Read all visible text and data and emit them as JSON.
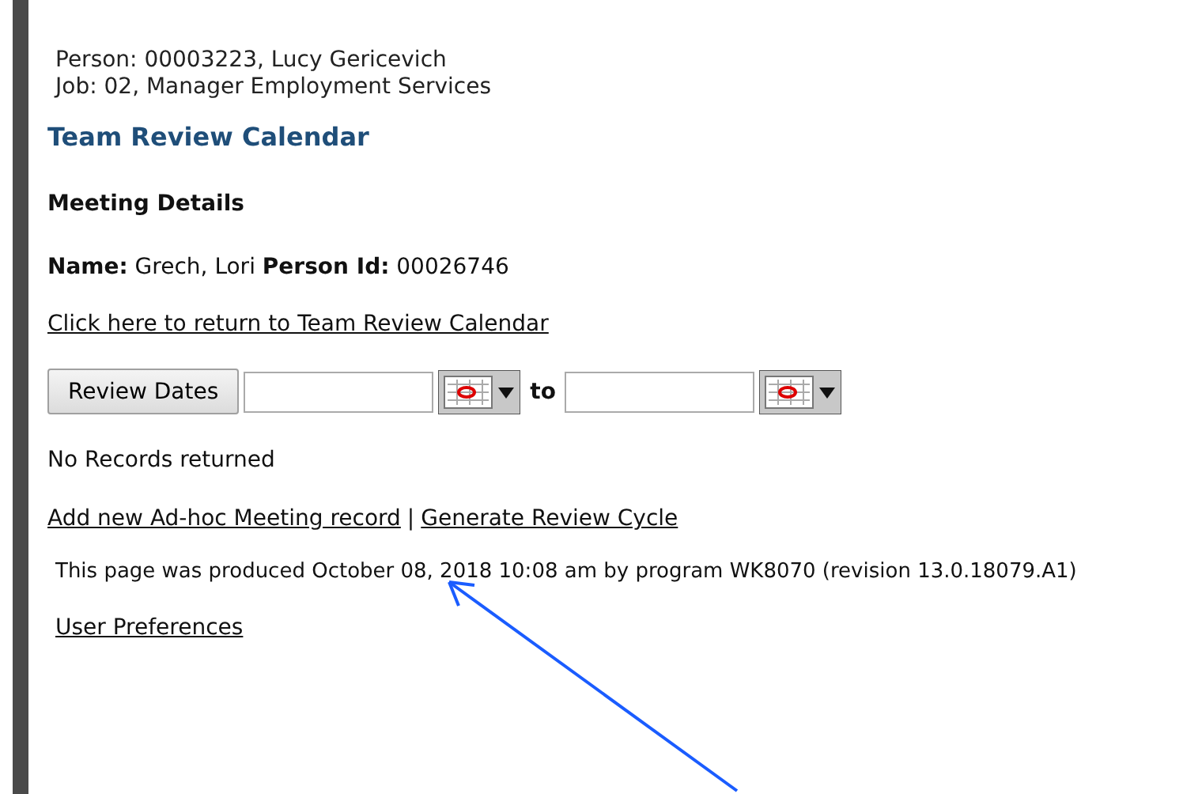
{
  "header": {
    "person": "Person: 00003223, Lucy Gericevich",
    "job": "Job: 02, Manager Employment Services"
  },
  "title": "Team Review Calendar",
  "section": "Meeting Details",
  "details": "**Name:** Grech, Lori **Person Id:** 00026746",
  "return_link": "Click here to return to Team Review Calendar",
  "date_filter": {
    "button": "Review Dates",
    "separator": "to"
  },
  "status": "No Records returned",
  "links": [
    {
      "label": "Add new Ad-hoc Meeting record"
    },
    {
      "label": "Generate Review Cycle"
    }
  ],
  "link_separator": "|",
  "footer": "This page was produced October 08, 2018 10:08 am by program WK8070 (revision 13.0.18079.A1)",
  "preferences_link": "User Preferences"
}
